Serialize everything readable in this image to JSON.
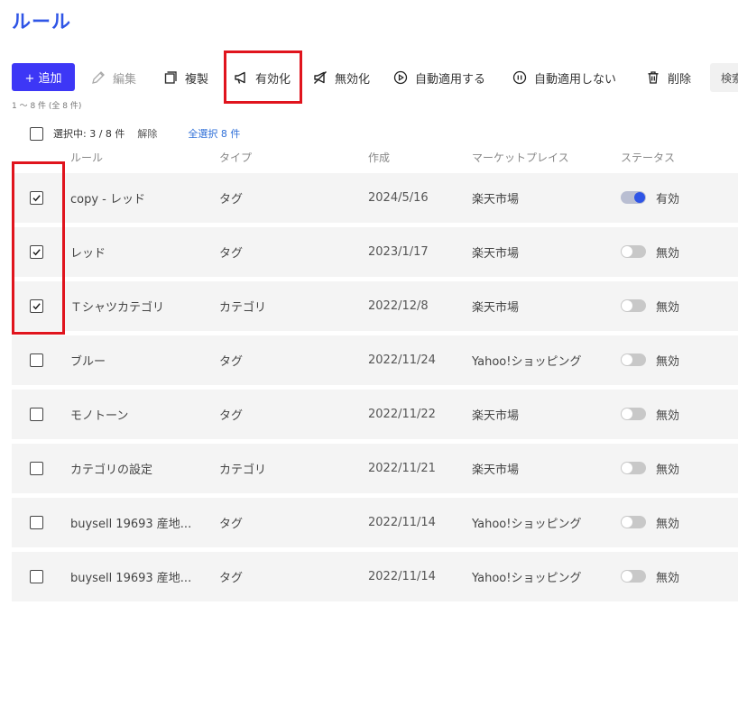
{
  "page": {
    "title": "ルール"
  },
  "toolbar": {
    "add_label": "+ 追加",
    "edit_label": "編集",
    "duplicate_label": "複製",
    "enable_label": "有効化",
    "disable_label": "無効化",
    "auto_apply_label": "自動適用する",
    "no_auto_apply_label": "自動適用しない",
    "delete_label": "削除",
    "search_label": "検索"
  },
  "summary": {
    "count_text": "1 〜 8 件 (全 8 件)"
  },
  "selection": {
    "selected_text": "選択中: 3 / 8 件",
    "clear_label": "解除",
    "select_all_label": "全選択 8 件"
  },
  "table": {
    "columns": {
      "rule": "ルール",
      "type": "タイプ",
      "created": "作成",
      "marketplace": "マーケットプレイス",
      "status": "ステータス"
    },
    "rows": [
      {
        "checked": true,
        "name": "copy - レッド",
        "type": "タグ",
        "created": "2024/5/16",
        "marketplace": "楽天市場",
        "enabled": true,
        "status": "有効"
      },
      {
        "checked": true,
        "name": "レッド",
        "type": "タグ",
        "created": "2023/1/17",
        "marketplace": "楽天市場",
        "enabled": false,
        "status": "無効"
      },
      {
        "checked": true,
        "name": "Ｔシャツカテゴリ",
        "type": "カテゴリ",
        "created": "2022/12/8",
        "marketplace": "楽天市場",
        "enabled": false,
        "status": "無効"
      },
      {
        "checked": false,
        "name": "ブルー",
        "type": "タグ",
        "created": "2022/11/24",
        "marketplace": "Yahoo!ショッピング",
        "enabled": false,
        "status": "無効"
      },
      {
        "checked": false,
        "name": "モノトーン",
        "type": "タグ",
        "created": "2022/11/22",
        "marketplace": "楽天市場",
        "enabled": false,
        "status": "無効"
      },
      {
        "checked": false,
        "name": "カテゴリの設定",
        "type": "カテゴリ",
        "created": "2022/11/21",
        "marketplace": "楽天市場",
        "enabled": false,
        "status": "無効"
      },
      {
        "checked": false,
        "name": "buysell 19693 産地...",
        "type": "タグ",
        "created": "2022/11/14",
        "marketplace": "Yahoo!ショッピング",
        "enabled": false,
        "status": "無効"
      },
      {
        "checked": false,
        "name": "buysell 19693 産地...",
        "type": "タグ",
        "created": "2022/11/14",
        "marketplace": "Yahoo!ショッピング",
        "enabled": false,
        "status": "無効"
      }
    ]
  },
  "colors": {
    "accent": "#2f55e6",
    "add_button": "#3d37f6",
    "highlight": "#e0141d",
    "row_bg": "#f4f4f4",
    "link": "#2f6fd8"
  },
  "icons": {
    "edit": "pencil-icon",
    "duplicate": "copy-icon",
    "enable": "megaphone-icon",
    "disable": "megaphone-off-icon",
    "auto_apply": "play-circle-icon",
    "no_auto_apply": "pause-circle-icon",
    "delete": "trash-icon",
    "check": "check-icon"
  }
}
